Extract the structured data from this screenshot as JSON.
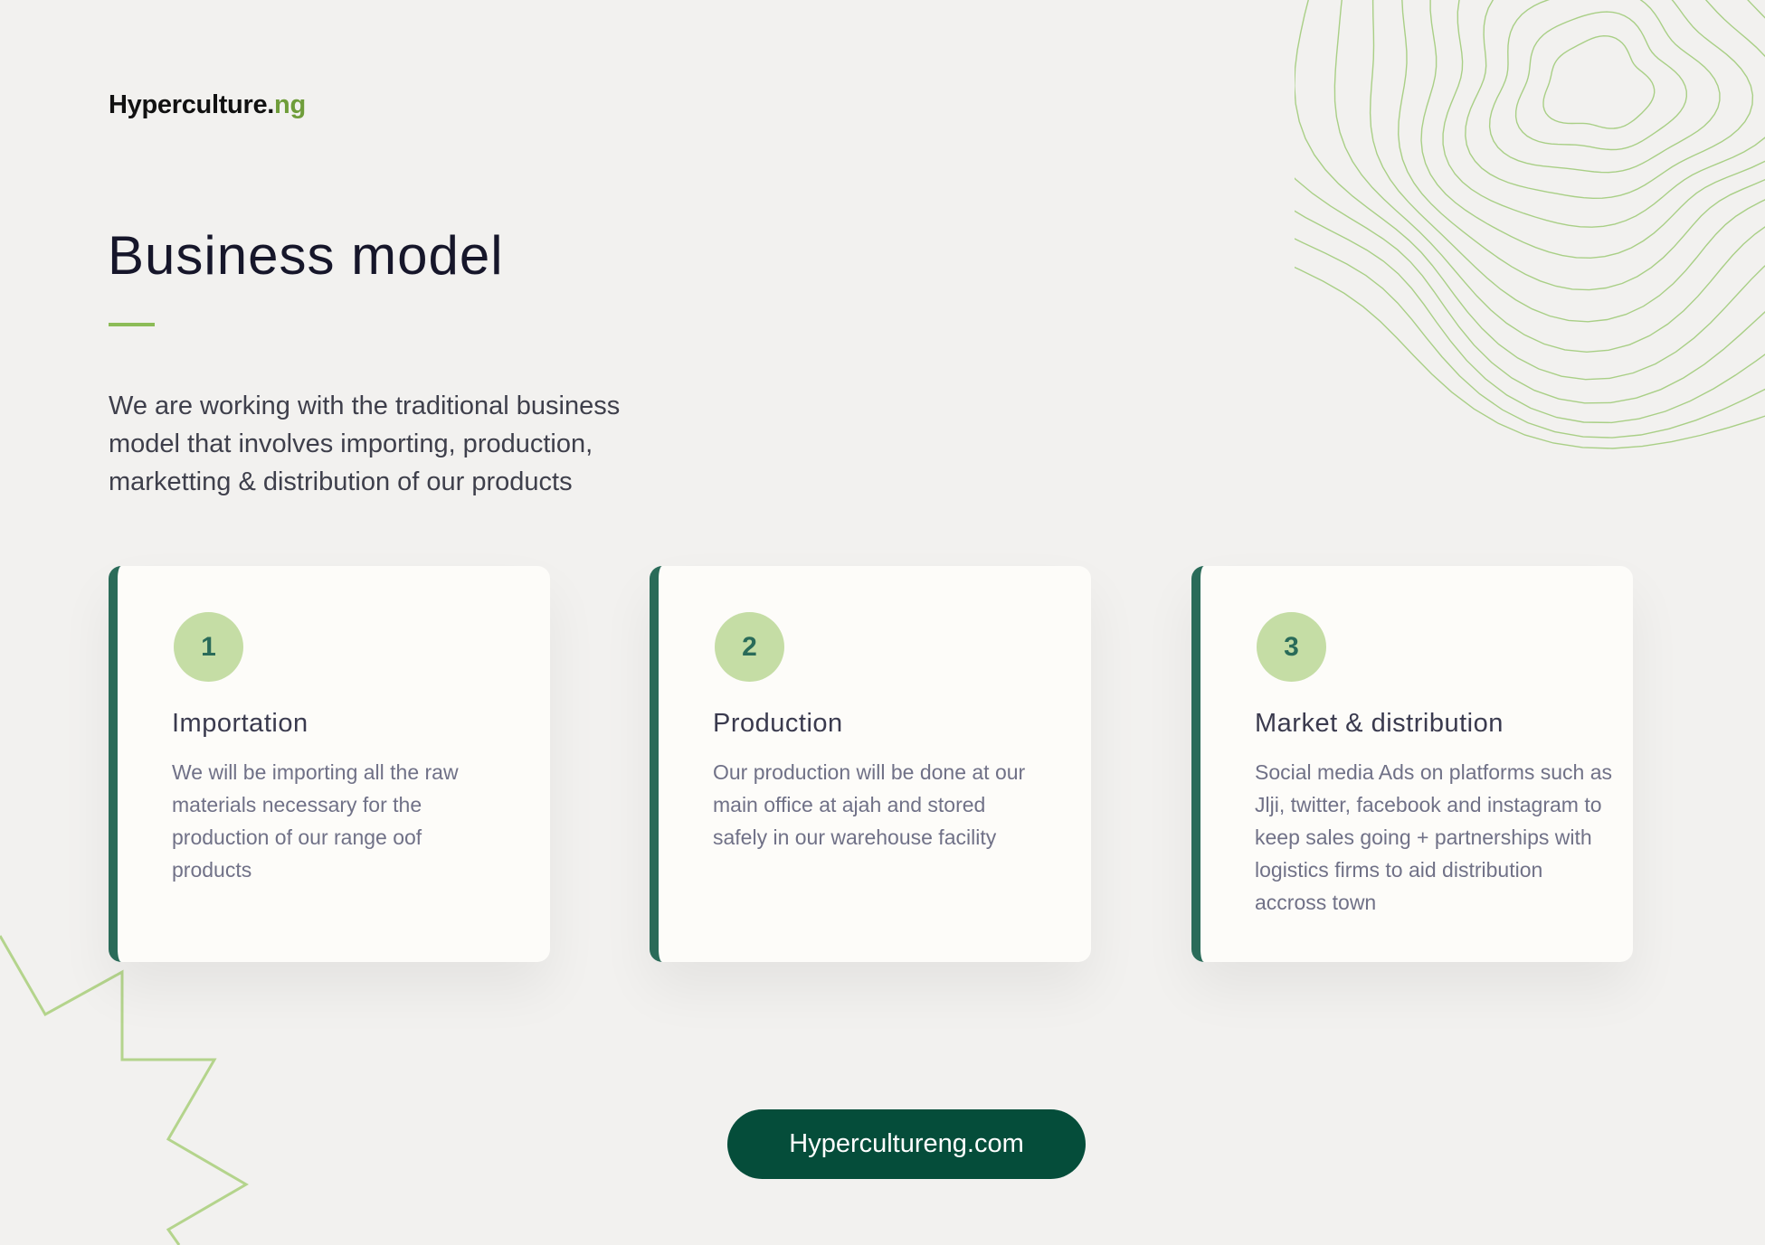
{
  "brand": {
    "name": "Hyperculture.",
    "suffix": "ng"
  },
  "header": {
    "title": "Business model"
  },
  "intro": {
    "text": "We are working with the traditional business model that involves importing, production, marketting &  distribution of our products"
  },
  "cards": [
    {
      "number": "1",
      "title": "Importation",
      "description": "We will be importing all the raw materials necessary for the production of our range oof products"
    },
    {
      "number": "2",
      "title": "Production",
      "description": "Our production will be done at our main office at ajah and stored safely in our warehouse facility"
    },
    {
      "number": "3",
      "title": "Market & distribution",
      "description": "Social media Ads on platforms such as Jlji, twitter, facebook and instagram to keep sales going + partnerships with logistics firms to aid distribution accross town"
    }
  ],
  "cta": {
    "label": "Hypercultureng.com"
  },
  "colors": {
    "accent_green": "#8cbc57",
    "card_border": "#2a6b59",
    "badge_fill": "#c5dda5",
    "button_bg": "#054d3a",
    "background": "#f2f1ef"
  },
  "decorations": {
    "top_right": "topographic-lines-icon",
    "bottom_left": "zigzag-line-icon"
  }
}
